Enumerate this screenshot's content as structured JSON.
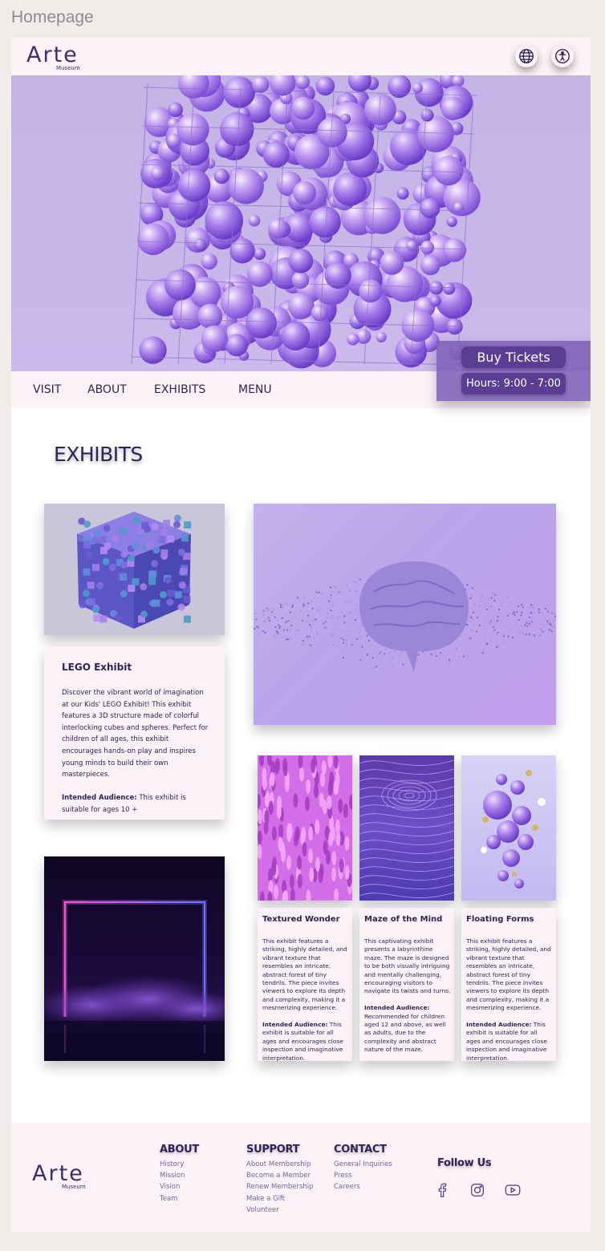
{
  "frame_label": "Homepage",
  "brand": {
    "name": "Arte",
    "sub": "Museum"
  },
  "header": {
    "icons": [
      "globe-icon",
      "accessibility-icon"
    ]
  },
  "nav": {
    "items": [
      "VISIT",
      "ABOUT",
      "EXHIBITS",
      "MENU"
    ]
  },
  "tickets": {
    "buy_label": "Buy Tickets",
    "hours_label": "Hours: 9:00 - 7:00"
  },
  "exhibits": {
    "title": "EXHIBITS",
    "lego": {
      "title": "LEGO Exhibit",
      "description": "Discover the vibrant world of imagination at our Kids' LEGO Exhibit! This exhibit features a 3D structure made of colorful interlocking cubes and spheres. Perfect for children of all ages, this exhibit encourages hands-on play and inspires young minds to build their own masterpieces.",
      "audience_label": "Intended Audience:",
      "audience_text": " This exhibit is suitable for  ages 10 +"
    },
    "textured": {
      "title": "Textured Wonder",
      "description": "This exhibit features a striking, highly detailed, and vibrant texture that resembles an intricate, abstract forest of tiny tendrils. The piece invites viewers to explore its depth and complexity, making it a mesmerizing experience.",
      "audience_label": "Intended Audience:",
      "audience_text": " This exhibit is suitable for all ages and encourages close inspection and imaginative interpretation."
    },
    "maze": {
      "title": "Maze of the Mind",
      "description": "This captivating exhibit presents a labyrinthine maze. The maze is designed to be both visually intriguing and mentally challenging, encouraging visitors to navigate its twists and turns.",
      "audience_label": "Intended Audience:",
      "audience_text": " Recommended for children aged 12 and above, as well as adults, due to the complexity and abstract nature of the maze."
    },
    "floating": {
      "title": "Floating Forms",
      "description": "This exhibit features a striking, highly detailed, and vibrant texture that resembles an intricate, abstract forest of tiny tendrils. The piece invites viewers to explore its depth and complexity, making it a mesmerizing experience.",
      "audience_label": "Intended Audience:",
      "audience_text": " This exhibit is suitable for all ages and encourages close inspection and imaginative interpretation."
    }
  },
  "footer": {
    "about": {
      "title": "ABOUT",
      "links": [
        "History",
        "Mission",
        "Vision",
        "Team"
      ]
    },
    "support": {
      "title": "SUPPORT",
      "links": [
        "About Membership",
        "Become a Member",
        "Renew Membership",
        "Make a Gift",
        "Volunteer"
      ]
    },
    "contact": {
      "title": "CONTACT",
      "links": [
        "General Inquiries",
        "Press",
        "Careers"
      ]
    },
    "follow_label": "Follow Us",
    "social_icons": [
      "facebook-icon",
      "instagram-icon",
      "youtube-icon"
    ]
  },
  "colors": {
    "brand": "#2f2457",
    "accent": "#5b3e94",
    "panel": "#fdf2f8",
    "hero": "#c8b6e8"
  }
}
